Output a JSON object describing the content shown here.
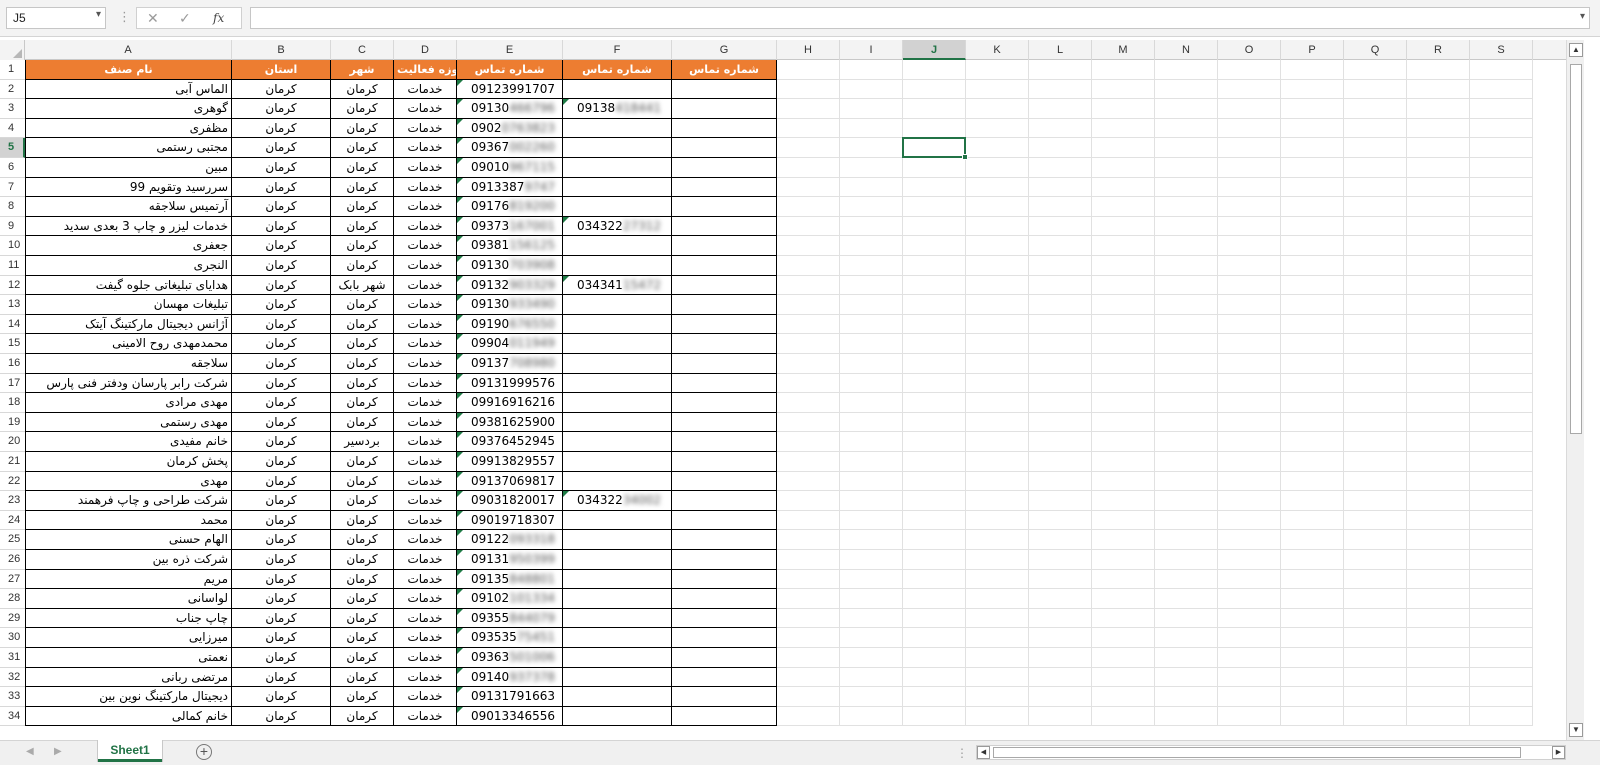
{
  "formula_bar": {
    "name_box": "J5",
    "name_box_arrow": "▾",
    "dots": "⋮",
    "cancel_icon": "✕",
    "enter_icon": "✓",
    "fx_label": "fx",
    "formula_value": "",
    "expand_icon": "▾"
  },
  "columns": [
    "A",
    "B",
    "C",
    "D",
    "E",
    "F",
    "G",
    "H",
    "I",
    "J",
    "K",
    "L",
    "M",
    "N",
    "O",
    "P",
    "Q",
    "R",
    "S"
  ],
  "selected_column": "J",
  "selected_row": 5,
  "headers": [
    "نام صنف",
    "استان",
    "شهر",
    "حوزه فعالیت",
    "شماره تماس",
    "شماره تماس",
    "شماره تماس"
  ],
  "rows": [
    {
      "n": "2",
      "name": "الماس آبی",
      "province": "کرمان",
      "city": "کرمان",
      "field": "خدمات",
      "phone_visible": "09123991707",
      "phone_blur": "",
      "phone2": "",
      "phone2_blur": ""
    },
    {
      "n": "3",
      "name": "گوهری",
      "province": "کرمان",
      "city": "کرمان",
      "field": "خدمات",
      "phone_visible": "09130",
      "phone_blur": "466796",
      "phone2": "09138",
      "phone2_blur": "418441"
    },
    {
      "n": "4",
      "name": "مظفری",
      "province": "کرمان",
      "city": "کرمان",
      "field": "خدمات",
      "phone_visible": "0902",
      "phone_blur": "0763823",
      "phone2": "",
      "phone2_blur": ""
    },
    {
      "n": "5",
      "name": "مجتبی رستمی",
      "province": "کرمان",
      "city": "کرمان",
      "field": "خدمات",
      "phone_visible": "09367",
      "phone_blur": "002260",
      "phone2": "",
      "phone2_blur": ""
    },
    {
      "n": "6",
      "name": "مبین",
      "province": "کرمان",
      "city": "کرمان",
      "field": "خدمات",
      "phone_visible": "09010",
      "phone_blur": "967115",
      "phone2": "",
      "phone2_blur": ""
    },
    {
      "n": "7",
      "name": "سررسید وتقویم 99",
      "province": "کرمان",
      "city": "کرمان",
      "field": "خدمات",
      "phone_visible": "0913387",
      "phone_blur": "9747",
      "phone2": "",
      "phone2_blur": ""
    },
    {
      "n": "8",
      "name": "آرتمیس سلاجقه",
      "province": "کرمان",
      "city": "کرمان",
      "field": "خدمات",
      "phone_visible": "09176",
      "phone_blur": "819200",
      "phone2": "",
      "phone2_blur": ""
    },
    {
      "n": "9",
      "name": "خدمات لیزر و چاپ 3 بعدی سدید",
      "province": "کرمان",
      "city": "کرمان",
      "field": "خدمات",
      "phone_visible": "09373",
      "phone_blur": "167001",
      "phone2": "034322",
      "phone2_blur": "27312"
    },
    {
      "n": "10",
      "name": "جعفری",
      "province": "کرمان",
      "city": "کرمان",
      "field": "خدمات",
      "phone_visible": "09381",
      "phone_blur": "156125",
      "phone2": "",
      "phone2_blur": ""
    },
    {
      "n": "11",
      "name": "النجری",
      "province": "کرمان",
      "city": "کرمان",
      "field": "خدمات",
      "phone_visible": "09130",
      "phone_blur": "703908",
      "phone2": "",
      "phone2_blur": ""
    },
    {
      "n": "12",
      "name": "هدایای تبلیغاتی جلوه گیفت",
      "province": "کرمان",
      "city": "شهر بابک",
      "field": "خدمات",
      "phone_visible": "09132",
      "phone_blur": "903329",
      "phone2": "034341",
      "phone2_blur": "15472"
    },
    {
      "n": "13",
      "name": "تبلیغات مهسان",
      "province": "کرمان",
      "city": "کرمان",
      "field": "خدمات",
      "phone_visible": "09130",
      "phone_blur": "933490",
      "phone2": "",
      "phone2_blur": ""
    },
    {
      "n": "14",
      "name": "آژانس دیجیتال مارکتینگ آیتک",
      "province": "کرمان",
      "city": "کرمان",
      "field": "خدمات",
      "phone_visible": "09190",
      "phone_blur": "676550",
      "phone2": "",
      "phone2_blur": ""
    },
    {
      "n": "15",
      "name": "محمدمهدی روح الامینی",
      "province": "کرمان",
      "city": "کرمان",
      "field": "خدمات",
      "phone_visible": "09904",
      "phone_blur": "011949",
      "phone2": "",
      "phone2_blur": ""
    },
    {
      "n": "16",
      "name": "سلاجقه",
      "province": "کرمان",
      "city": "کرمان",
      "field": "خدمات",
      "phone_visible": "09137",
      "phone_blur": "708980",
      "phone2": "",
      "phone2_blur": ""
    },
    {
      "n": "17",
      "name": "شرکت رابر پارسان ودفتر فنی پارس",
      "province": "کرمان",
      "city": "کرمان",
      "field": "خدمات",
      "phone_visible": "09131999576",
      "phone_blur": "",
      "phone2": "",
      "phone2_blur": ""
    },
    {
      "n": "18",
      "name": "مهدی مرادی",
      "province": "کرمان",
      "city": "کرمان",
      "field": "خدمات",
      "phone_visible": "09916916216",
      "phone_blur": "",
      "phone2": "",
      "phone2_blur": ""
    },
    {
      "n": "19",
      "name": "مهدی رستمی",
      "province": "کرمان",
      "city": "کرمان",
      "field": "خدمات",
      "phone_visible": "09381625900",
      "phone_blur": "",
      "phone2": "",
      "phone2_blur": ""
    },
    {
      "n": "20",
      "name": "خانم مفیدی",
      "province": "کرمان",
      "city": "بردسیر",
      "field": "خدمات",
      "phone_visible": "09376452945",
      "phone_blur": "",
      "phone2": "",
      "phone2_blur": ""
    },
    {
      "n": "21",
      "name": "پخش کرمان",
      "province": "کرمان",
      "city": "کرمان",
      "field": "خدمات",
      "phone_visible": "09913829557",
      "phone_blur": "",
      "phone2": "",
      "phone2_blur": ""
    },
    {
      "n": "22",
      "name": "مهدی",
      "province": "کرمان",
      "city": "کرمان",
      "field": "خدمات",
      "phone_visible": "09137069817",
      "phone_blur": "",
      "phone2": "",
      "phone2_blur": ""
    },
    {
      "n": "23",
      "name": "شرکت طراحی و چاپ فرهمند",
      "province": "کرمان",
      "city": "کرمان",
      "field": "خدمات",
      "phone_visible": "09031820017",
      "phone_blur": "",
      "phone2": "034322",
      "phone2_blur": "34002"
    },
    {
      "n": "24",
      "name": "محمد",
      "province": "کرمان",
      "city": "کرمان",
      "field": "خدمات",
      "phone_visible": "09019718307",
      "phone_blur": "",
      "phone2": "",
      "phone2_blur": ""
    },
    {
      "n": "25",
      "name": "الهام حسنی",
      "province": "کرمان",
      "city": "کرمان",
      "field": "خدمات",
      "phone_visible": "09122",
      "phone_blur": "093318",
      "phone2": "",
      "phone2_blur": ""
    },
    {
      "n": "26",
      "name": "شرکت ذره بین",
      "province": "کرمان",
      "city": "کرمان",
      "field": "خدمات",
      "phone_visible": "09131",
      "phone_blur": "950399",
      "phone2": "",
      "phone2_blur": ""
    },
    {
      "n": "27",
      "name": "مریم",
      "province": "کرمان",
      "city": "کرمان",
      "field": "خدمات",
      "phone_visible": "09135",
      "phone_blur": "848801",
      "phone2": "",
      "phone2_blur": ""
    },
    {
      "n": "28",
      "name": "لواسانی",
      "province": "کرمان",
      "city": "کرمان",
      "field": "خدمات",
      "phone_visible": "09102",
      "phone_blur": "101334",
      "phone2": "",
      "phone2_blur": ""
    },
    {
      "n": "29",
      "name": "چاپ جناب",
      "province": "کرمان",
      "city": "کرمان",
      "field": "خدمات",
      "phone_visible": "09355",
      "phone_blur": "844079",
      "phone2": "",
      "phone2_blur": ""
    },
    {
      "n": "30",
      "name": "میرزایی",
      "province": "کرمان",
      "city": "کرمان",
      "field": "خدمات",
      "phone_visible": "093535",
      "phone_blur": "75451",
      "phone2": "",
      "phone2_blur": ""
    },
    {
      "n": "31",
      "name": "نعمتی",
      "province": "کرمان",
      "city": "کرمان",
      "field": "خدمات",
      "phone_visible": "09363",
      "phone_blur": "501006",
      "phone2": "",
      "phone2_blur": ""
    },
    {
      "n": "32",
      "name": "مرتضی ربانی",
      "province": "کرمان",
      "city": "کرمان",
      "field": "خدمات",
      "phone_visible": "09140",
      "phone_blur": "937378",
      "phone2": "",
      "phone2_blur": ""
    },
    {
      "n": "33",
      "name": "دیجیتال مارکتینگ نوین بین",
      "province": "کرمان",
      "city": "کرمان",
      "field": "خدمات",
      "phone_visible": "09131791663",
      "phone_blur": "",
      "phone2": "",
      "phone2_blur": ""
    },
    {
      "n": "34",
      "name": "خانم کمالی",
      "province": "کرمان",
      "city": "کرمان",
      "field": "خدمات",
      "phone_visible": "09013346556",
      "phone_blur": "",
      "phone2": "",
      "phone2_blur": ""
    }
  ],
  "sheet_tabs": {
    "active_tab": "Sheet1",
    "add_icon": "+",
    "nav_left": "◀",
    "nav_right": "▶",
    "dots": "⋮"
  },
  "scroll": {
    "up": "▲",
    "down": "▼",
    "left": "◀",
    "right": "▶"
  },
  "colors": {
    "header_fill": "#ed7d31",
    "accent": "#217346",
    "indicator": "#1e7b45"
  }
}
